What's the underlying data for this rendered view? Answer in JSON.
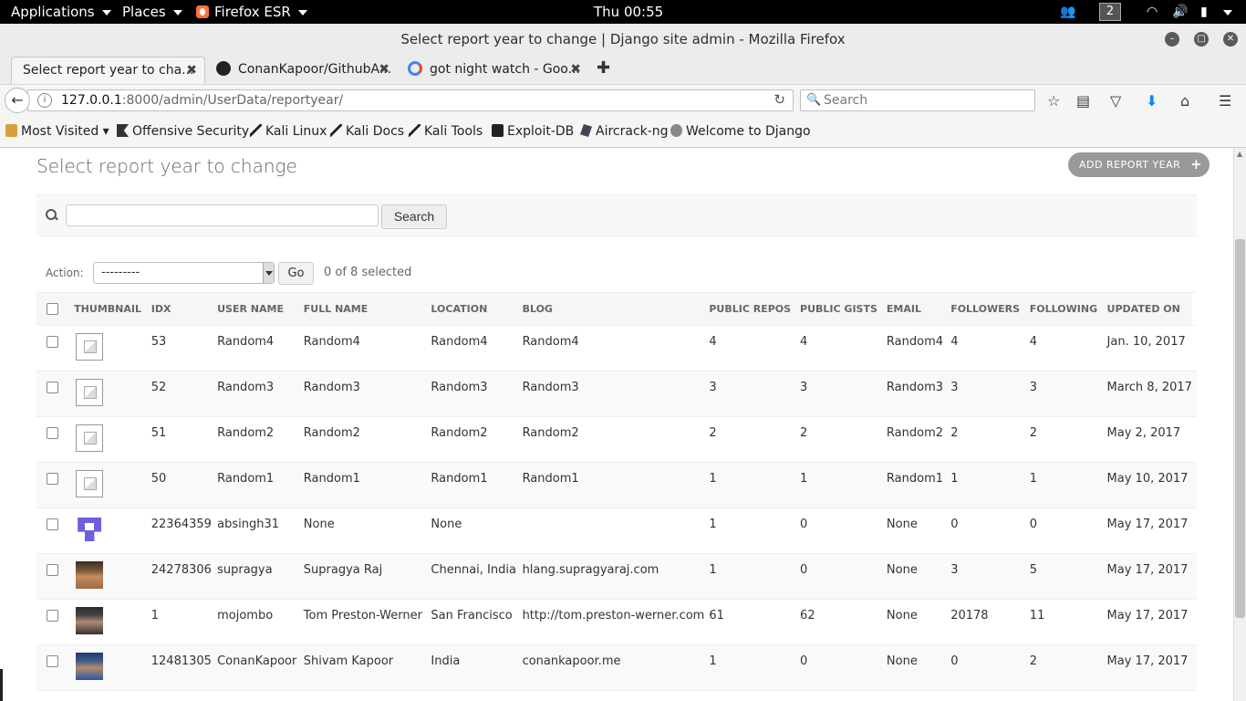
{
  "topbar": {
    "applications": "Applications",
    "places": "Places",
    "firefox": "Firefox ESR",
    "clock": "Thu 00:55",
    "workspace": "2"
  },
  "window": {
    "title": "Select report year to change | Django site admin - Mozilla Firefox"
  },
  "tabs": [
    {
      "label": "Select report year to cha..."
    },
    {
      "label": "ConanKapoor/GithubA..."
    },
    {
      "label": "got night watch - Goo..."
    }
  ],
  "navbar": {
    "url_host": "127.0.0.1",
    "url_rest": ":8000/admin/UserData/reportyear/",
    "search_placeholder": "Search"
  },
  "bookmarks": [
    {
      "label": "Most Visited ▾",
      "icon": "folder-icon"
    },
    {
      "label": "Offensive Security",
      "icon": "dragon-icon"
    },
    {
      "label": "Kali Linux",
      "icon": "kali-icon"
    },
    {
      "label": "Kali Docs",
      "icon": "kali-icon"
    },
    {
      "label": "Kali Tools",
      "icon": "kali-icon"
    },
    {
      "label": "Exploit-DB",
      "icon": "exploitdb-icon"
    },
    {
      "label": "Aircrack-ng",
      "icon": "aircrack-icon"
    },
    {
      "label": "Welcome to Django",
      "icon": "globe-icon"
    }
  ],
  "page": {
    "heading": "Select report year to change",
    "add_label": "ADD REPORT YEAR",
    "search_button": "Search",
    "action_label": "Action:",
    "action_value": "---------",
    "go_label": "Go",
    "selected_count": "0 of 8 selected"
  },
  "table": {
    "headers": [
      "THUMBNAIL",
      "IDX",
      "USER NAME",
      "FULL NAME",
      "LOCATION",
      "BLOG",
      "PUBLIC REPOS",
      "PUBLIC GISTS",
      "EMAIL",
      "FOLLOWERS",
      "FOLLOWING",
      "UPDATED ON"
    ],
    "rows": [
      {
        "thumb": "broken",
        "idx": "53",
        "user": "Random4",
        "full": "Random4",
        "loc": "Random4",
        "blog": "Random4",
        "repos": "4",
        "gists": "4",
        "email": "Random4",
        "followers": "4",
        "following": "4",
        "updated": "Jan. 10, 2017"
      },
      {
        "thumb": "broken",
        "idx": "52",
        "user": "Random3",
        "full": "Random3",
        "loc": "Random3",
        "blog": "Random3",
        "repos": "3",
        "gists": "3",
        "email": "Random3",
        "followers": "3",
        "following": "3",
        "updated": "March 8, 2017"
      },
      {
        "thumb": "broken",
        "idx": "51",
        "user": "Random2",
        "full": "Random2",
        "loc": "Random2",
        "blog": "Random2",
        "repos": "2",
        "gists": "2",
        "email": "Random2",
        "followers": "2",
        "following": "2",
        "updated": "May 2, 2017"
      },
      {
        "thumb": "broken",
        "idx": "50",
        "user": "Random1",
        "full": "Random1",
        "loc": "Random1",
        "blog": "Random1",
        "repos": "1",
        "gists": "1",
        "email": "Random1",
        "followers": "1",
        "following": "1",
        "updated": "May 10, 2017"
      },
      {
        "thumb": "identicon",
        "idx": "22364359",
        "user": "absingh31",
        "full": "None",
        "loc": "None",
        "blog": "",
        "repos": "1",
        "gists": "0",
        "email": "None",
        "followers": "0",
        "following": "0",
        "updated": "May 17, 2017"
      },
      {
        "thumb": "photo1",
        "idx": "24278306",
        "user": "supragya",
        "full": "Supragya Raj",
        "loc": "Chennai, India",
        "blog": "hlang.supragyaraj.com",
        "repos": "1",
        "gists": "0",
        "email": "None",
        "followers": "3",
        "following": "5",
        "updated": "May 17, 2017"
      },
      {
        "thumb": "photo2",
        "idx": "1",
        "user": "mojombo",
        "full": "Tom Preston-Werner",
        "loc": "San Francisco",
        "blog": "http://tom.preston-werner.com",
        "repos": "61",
        "gists": "62",
        "email": "None",
        "followers": "20178",
        "following": "11",
        "updated": "May 17, 2017"
      },
      {
        "thumb": "photo3",
        "idx": "12481305",
        "user": "ConanKapoor",
        "full": "Shivam Kapoor",
        "loc": "India",
        "blog": "conankapoor.me",
        "repos": "1",
        "gists": "0",
        "email": "None",
        "followers": "0",
        "following": "2",
        "updated": "May 17, 2017"
      }
    ]
  }
}
